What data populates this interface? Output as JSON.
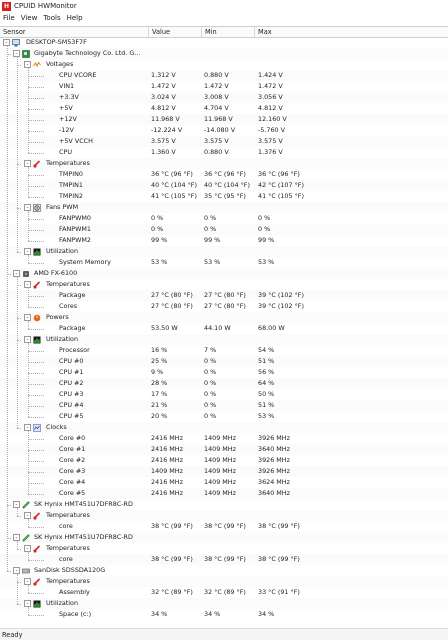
{
  "window": {
    "title": "CPUID HWMonitor",
    "icon_letter": "H"
  },
  "menu": [
    "File",
    "View",
    "Tools",
    "Help"
  ],
  "columns": [
    "Sensor",
    "Value",
    "Min",
    "Max"
  ],
  "status": "Ready",
  "rows": [
    {
      "level": 0,
      "label": "DESKTOP-SM53F7F",
      "icon": "computer-icon",
      "exp": "-"
    },
    {
      "level": 1,
      "label": "Gigabyte Technology Co. Ltd. G...",
      "icon": "motherboard-icon",
      "exp": "-"
    },
    {
      "level": 2,
      "label": "Voltages",
      "icon": "voltage-icon",
      "exp": "-"
    },
    {
      "level": 3,
      "label": "CPU VCORE",
      "value": "1.312 V",
      "min": "0.880 V",
      "max": "1.424 V"
    },
    {
      "level": 3,
      "label": "VIN1",
      "value": "1.472 V",
      "min": "1.472 V",
      "max": "1.472 V"
    },
    {
      "level": 3,
      "label": "+3.3V",
      "value": "3.024 V",
      "min": "3.008 V",
      "max": "3.056 V"
    },
    {
      "level": 3,
      "label": "+5V",
      "value": "4.812 V",
      "min": "4.704 V",
      "max": "4.812 V"
    },
    {
      "level": 3,
      "label": "+12V",
      "value": "11.968 V",
      "min": "11.968 V",
      "max": "12.160 V"
    },
    {
      "level": 3,
      "label": "-12V",
      "value": "-12.224 V",
      "min": "-14.080 V",
      "max": "-5.760 V"
    },
    {
      "level": 3,
      "label": "+5V VCCH",
      "value": "3.575 V",
      "min": "3.575 V",
      "max": "3.575 V"
    },
    {
      "level": 3,
      "label": "CPU",
      "value": "1.360 V",
      "min": "0.880 V",
      "max": "1.376 V"
    },
    {
      "level": 2,
      "label": "Temperatures",
      "icon": "thermometer-icon",
      "exp": "-"
    },
    {
      "level": 3,
      "label": "TMPIN0",
      "value": "36 °C (96 °F)",
      "min": "36 °C (96 °F)",
      "max": "36 °C (96 °F)"
    },
    {
      "level": 3,
      "label": "TMPIN1",
      "value": "40 °C (104 °F)",
      "min": "40 °C (104 °F)",
      "max": "42 °C (107 °F)"
    },
    {
      "level": 3,
      "label": "TMPIN2",
      "value": "41 °C (105 °F)",
      "min": "35 °C (95 °F)",
      "max": "41 °C (105 °F)"
    },
    {
      "level": 2,
      "label": "Fans PWM",
      "icon": "fan-icon",
      "exp": "-"
    },
    {
      "level": 3,
      "label": "FANPWM0",
      "value": "0 %",
      "min": "0 %",
      "max": "0 %"
    },
    {
      "level": 3,
      "label": "FANPWM1",
      "value": "0 %",
      "min": "0 %",
      "max": "0 %"
    },
    {
      "level": 3,
      "label": "FANPWM2",
      "value": "99 %",
      "min": "99 %",
      "max": "99 %"
    },
    {
      "level": 2,
      "label": "Utilization",
      "icon": "utilization-icon",
      "exp": "-"
    },
    {
      "level": 3,
      "label": "System Memory",
      "value": "53 %",
      "min": "53 %",
      "max": "53 %"
    },
    {
      "level": 1,
      "label": "AMD FX-6100",
      "icon": "cpu-icon",
      "exp": "-"
    },
    {
      "level": 2,
      "label": "Temperatures",
      "icon": "thermometer-icon",
      "exp": "-"
    },
    {
      "level": 3,
      "label": "Package",
      "value": "27 °C (80 °F)",
      "min": "27 °C (80 °F)",
      "max": "39 °C (102 °F)"
    },
    {
      "level": 3,
      "label": "Cores",
      "value": "27 °C (80 °F)",
      "min": "27 °C (80 °F)",
      "max": "39 °C (102 °F)"
    },
    {
      "level": 2,
      "label": "Powers",
      "icon": "power-icon",
      "exp": "-"
    },
    {
      "level": 3,
      "label": "Package",
      "value": "53.50 W",
      "min": "44.10 W",
      "max": "68.00 W"
    },
    {
      "level": 2,
      "label": "Utilization",
      "icon": "utilization-icon",
      "exp": "-"
    },
    {
      "level": 3,
      "label": "Processor",
      "value": "16 %",
      "min": "7 %",
      "max": "54 %"
    },
    {
      "level": 3,
      "label": "CPU #0",
      "value": "25 %",
      "min": "0 %",
      "max": "51 %"
    },
    {
      "level": 3,
      "label": "CPU #1",
      "value": "9 %",
      "min": "0 %",
      "max": "56 %"
    },
    {
      "level": 3,
      "label": "CPU #2",
      "value": "28 %",
      "min": "0 %",
      "max": "64 %"
    },
    {
      "level": 3,
      "label": "CPU #3",
      "value": "17 %",
      "min": "0 %",
      "max": "50 %"
    },
    {
      "level": 3,
      "label": "CPU #4",
      "value": "21 %",
      "min": "0 %",
      "max": "51 %"
    },
    {
      "level": 3,
      "label": "CPU #5",
      "value": "20 %",
      "min": "0 %",
      "max": "53 %"
    },
    {
      "level": 2,
      "label": "Clocks",
      "icon": "clock-icon",
      "exp": "-"
    },
    {
      "level": 3,
      "label": "Core #0",
      "value": "2416 MHz",
      "min": "1409 MHz",
      "max": "3926 MHz"
    },
    {
      "level": 3,
      "label": "Core #1",
      "value": "2416 MHz",
      "min": "1409 MHz",
      "max": "3640 MHz"
    },
    {
      "level": 3,
      "label": "Core #2",
      "value": "2416 MHz",
      "min": "1409 MHz",
      "max": "3926 MHz"
    },
    {
      "level": 3,
      "label": "Core #3",
      "value": "1409 MHz",
      "min": "1409 MHz",
      "max": "3926 MHz"
    },
    {
      "level": 3,
      "label": "Core #4",
      "value": "2416 MHz",
      "min": "1409 MHz",
      "max": "3624 MHz"
    },
    {
      "level": 3,
      "label": "Core #5",
      "value": "2416 MHz",
      "min": "1409 MHz",
      "max": "3640 MHz"
    },
    {
      "level": 1,
      "label": "SK Hynix HMT451U7DFR8C-RD",
      "icon": "memory-icon",
      "exp": "-"
    },
    {
      "level": 2,
      "label": "Temperatures",
      "icon": "thermometer-icon",
      "exp": "-"
    },
    {
      "level": 3,
      "label": "core",
      "value": "38 °C (99 °F)",
      "min": "38 °C (99 °F)",
      "max": "38 °C (99 °F)"
    },
    {
      "level": 1,
      "label": "SK Hynix HMT451U7DFR8C-RD",
      "icon": "memory-icon",
      "exp": "-"
    },
    {
      "level": 2,
      "label": "Temperatures",
      "icon": "thermometer-icon",
      "exp": "-"
    },
    {
      "level": 3,
      "label": "core",
      "value": "38 °C (99 °F)",
      "min": "38 °C (99 °F)",
      "max": "38 °C (99 °F)"
    },
    {
      "level": 1,
      "label": "SanDisk SDSSDA120G",
      "icon": "drive-icon",
      "exp": "-"
    },
    {
      "level": 2,
      "label": "Temperatures",
      "icon": "thermometer-icon",
      "exp": "-"
    },
    {
      "level": 3,
      "label": "Assembly",
      "value": "32 °C (89 °F)",
      "min": "32 °C (89 °F)",
      "max": "33 °C (91 °F)"
    },
    {
      "level": 2,
      "label": "Utilization",
      "icon": "utilization-icon",
      "exp": "-"
    },
    {
      "level": 3,
      "label": "Space (c:)",
      "value": "34 %",
      "min": "34 %",
      "max": "34 %"
    }
  ]
}
